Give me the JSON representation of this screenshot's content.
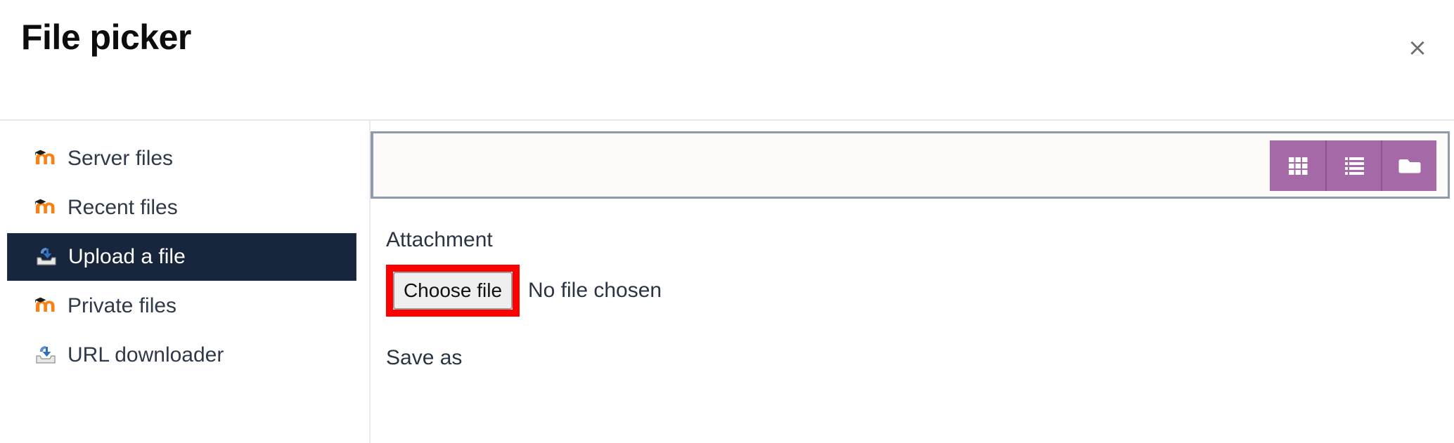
{
  "header": {
    "title": "File picker",
    "close_label": "×",
    "close_icon": "close-icon"
  },
  "sidebar": {
    "items": [
      {
        "label": "Server files",
        "icon": "moodle-logo-icon",
        "selected": false
      },
      {
        "label": "Recent files",
        "icon": "moodle-logo-icon",
        "selected": false
      },
      {
        "label": "Upload a file",
        "icon": "upload-tray-icon",
        "selected": true
      },
      {
        "label": "Private files",
        "icon": "moodle-logo-icon",
        "selected": false
      },
      {
        "label": "URL downloader",
        "icon": "upload-tray-icon",
        "selected": false
      }
    ]
  },
  "toolbar": {
    "view_buttons": [
      {
        "name": "icon-view-button",
        "icon": "grid-view-icon",
        "title": "View as icons"
      },
      {
        "name": "details-view-button",
        "icon": "list-view-icon",
        "title": "View as list"
      },
      {
        "name": "tree-view-button",
        "icon": "folder-tree-icon",
        "title": "View as tree"
      }
    ]
  },
  "form": {
    "attachment_label": "Attachment",
    "choose_file_label": "Choose file",
    "no_file_text": "No file chosen",
    "save_as_label": "Save as"
  },
  "colors": {
    "selected_sidebar_bg": "#17263c",
    "toolbar_purple": "#a569a8",
    "highlight_red": "#ff0000",
    "panel_border": "#8d9bac",
    "moodle_orange": "#f98012",
    "link_text": "#30394a"
  }
}
